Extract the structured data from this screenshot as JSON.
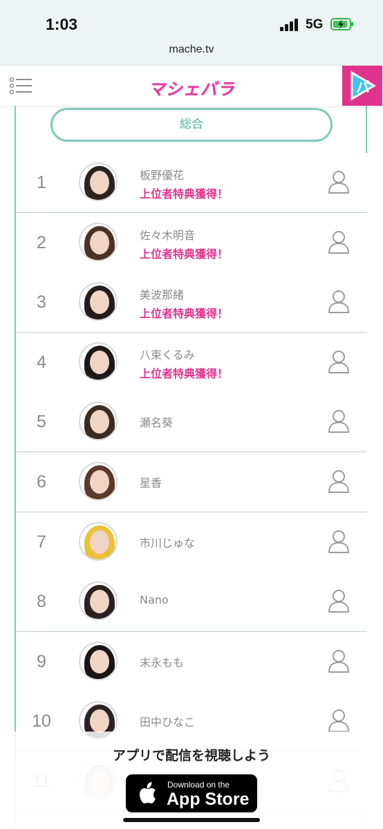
{
  "status_bar": {
    "time": "1:03",
    "network": "5G"
  },
  "browser": {
    "url": "mache.tv"
  },
  "header": {
    "logo_text": "マシェバラ"
  },
  "tabs": {
    "active_label": "総合"
  },
  "ranking": [
    {
      "rank": "1",
      "name": "板野優花",
      "perk": "上位者特典獲得！"
    },
    {
      "rank": "2",
      "name": "佐々木明音",
      "perk": "上位者特典獲得！"
    },
    {
      "rank": "3",
      "name": "美波那緒",
      "perk": "上位者特典獲得！"
    },
    {
      "rank": "4",
      "name": "八束くるみ",
      "perk": "上位者特典獲得！"
    },
    {
      "rank": "5",
      "name": "瀬名葵",
      "perk": ""
    },
    {
      "rank": "6",
      "name": "星香",
      "perk": ""
    },
    {
      "rank": "7",
      "name": "市川じゅな",
      "perk": ""
    },
    {
      "rank": "8",
      "name": "Nano",
      "perk": ""
    },
    {
      "rank": "9",
      "name": "末永もも",
      "perk": ""
    },
    {
      "rank": "10",
      "name": "田中ひなこ",
      "perk": ""
    },
    {
      "rank": "11",
      "name": "",
      "perk": ""
    }
  ],
  "promo": {
    "text": "アプリで配信を視聴しよう",
    "appstore_small": "Download on the",
    "appstore_big": "App Store"
  },
  "colors": {
    "accent_teal": "#7fc9bc",
    "accent_pink": "#e0338e"
  }
}
